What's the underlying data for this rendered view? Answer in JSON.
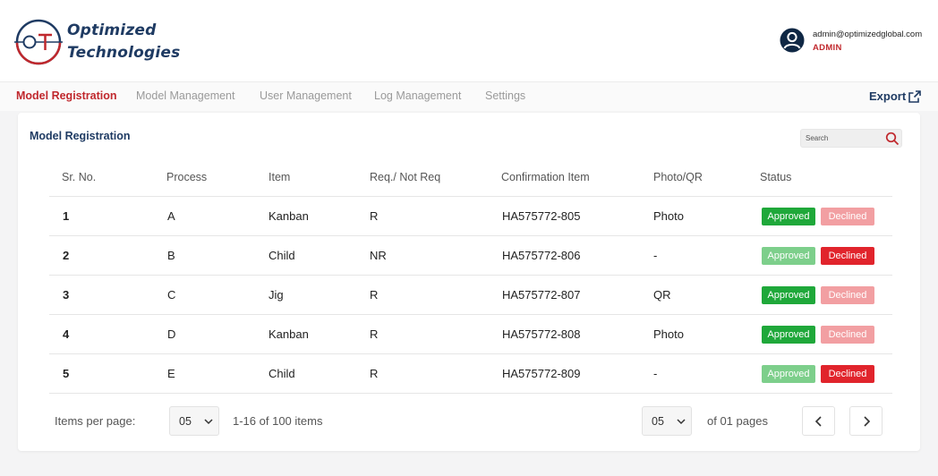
{
  "brand": {
    "line1": "Optimized",
    "line2": "Technologies",
    "accent": "#c0282d",
    "navy": "#1f3b63"
  },
  "user": {
    "email": "admin@optimizedglobal.com",
    "role": "ADMIN",
    "icon": "user-circle-icon"
  },
  "nav": {
    "items": [
      "Model Registration",
      "Model Management",
      "User Management",
      "Log Management",
      "Settings"
    ],
    "active_index": 0,
    "export_label": "Export",
    "export_icon": "external-link-icon"
  },
  "page": {
    "title": "Model Registration",
    "search_placeholder": "Search"
  },
  "table": {
    "headers": [
      "Sr. No.",
      "Process",
      "Item",
      "Req./ Not Req",
      "Confirmation Item",
      "Photo/QR",
      "Status"
    ],
    "rows": [
      {
        "sr": "1",
        "process": "A",
        "item": "Kanban",
        "req": "R",
        "confirmation": "HA575772-805",
        "photo": "Photo",
        "status": "approved"
      },
      {
        "sr": "2",
        "process": "B",
        "item": "Child",
        "req": "NR",
        "confirmation": "HA575772-806",
        "photo": "-",
        "status": "declined"
      },
      {
        "sr": "3",
        "process": "C",
        "item": "Jig",
        "req": "R",
        "confirmation": "HA575772-807",
        "photo": "QR",
        "status": "approved"
      },
      {
        "sr": "4",
        "process": "D",
        "item": "Kanban",
        "req": "R",
        "confirmation": "HA575772-808",
        "photo": "Photo",
        "status": "approved"
      },
      {
        "sr": "5",
        "process": "E",
        "item": "Child",
        "req": "R",
        "confirmation": "HA575772-809",
        "photo": "-",
        "status": "declined"
      }
    ],
    "approved_label": "Approved",
    "declined_label": "Declined"
  },
  "footer": {
    "items_per_page_label": "Items per page:",
    "items_per_page_value": "05",
    "range_text": "1-16 of 100 items",
    "page_value": "05",
    "pages_text": "of 01 pages"
  },
  "colors": {
    "approved": "#1fa83a",
    "approved_muted": "#7dcf8b",
    "declined": "#e1242c",
    "declined_muted": "#f29fa2"
  }
}
